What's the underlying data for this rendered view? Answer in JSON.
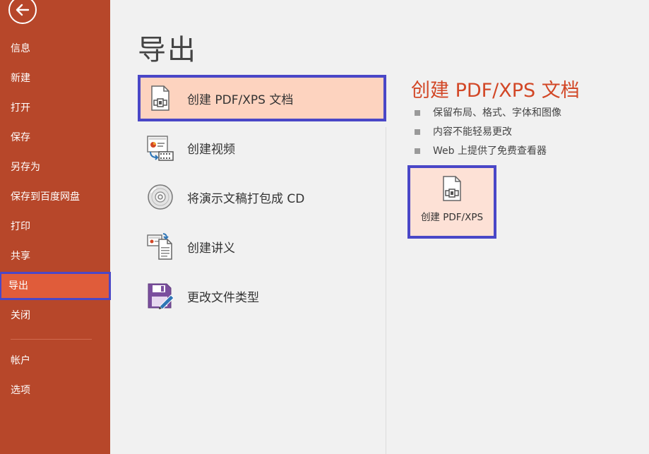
{
  "sidebar": {
    "items": [
      {
        "label": "信息"
      },
      {
        "label": "新建"
      },
      {
        "label": "打开"
      },
      {
        "label": "保存"
      },
      {
        "label": "另存为"
      },
      {
        "label": "保存到百度网盘"
      },
      {
        "label": "打印"
      },
      {
        "label": "共享"
      },
      {
        "label": "导出"
      },
      {
        "label": "关闭"
      }
    ],
    "bottom_items": [
      {
        "label": "帐户"
      },
      {
        "label": "选项"
      }
    ],
    "active_item": "导出",
    "back_icon": "back-arrow-icon"
  },
  "main": {
    "title": "导出",
    "options": [
      {
        "label": "创建 PDF/XPS 文档",
        "icon": "pdf-document-icon",
        "selected": true
      },
      {
        "label": "创建视频",
        "icon": "video-icon"
      },
      {
        "label": "将演示文稿打包成 CD",
        "icon": "cd-icon"
      },
      {
        "label": "创建讲义",
        "icon": "handout-icon"
      },
      {
        "label": "更改文件类型",
        "icon": "save-as-icon"
      }
    ]
  },
  "detail": {
    "title": "创建 PDF/XPS 文档",
    "bullets": [
      "保留布局、格式、字体和图像",
      "内容不能轻易更改",
      "Web 上提供了免费查看器"
    ],
    "button_label": "创建 PDF/XPS",
    "button_icon": "pdf-document-icon"
  },
  "colors": {
    "sidebar_bg": "#b7472a",
    "sidebar_active": "#e05c3a",
    "accent_title": "#d24726",
    "highlight_border": "#4a47c7",
    "selected_bg": "#fdd3bf"
  }
}
